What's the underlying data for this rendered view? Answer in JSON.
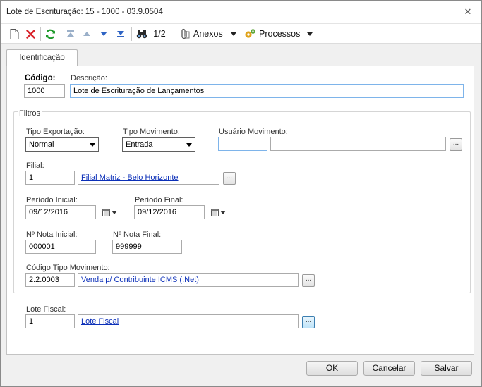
{
  "window": {
    "title": "Lote de Escrituração: 15 - 1000 - 03.9.0504",
    "close_glyph": "✕"
  },
  "toolbar": {
    "icons": [
      "new-icon",
      "delete-icon",
      "refresh-icon",
      "first-icon",
      "previous-icon",
      "next-icon",
      "last-icon",
      "search-binoculars-icon"
    ],
    "record_position": "1/2",
    "attachments_label": "Anexos",
    "processes_label": "Processos"
  },
  "tabs": [
    {
      "label": "Identificação"
    }
  ],
  "form": {
    "codigo": {
      "label": "Código:",
      "value": "1000"
    },
    "descricao": {
      "label": "Descrição:",
      "value": "Lote de Escrituração de Lançamentos"
    },
    "filtros": {
      "title": "Filtros",
      "tipo_exportacao": {
        "label": "Tipo Exportação:",
        "value": "Normal"
      },
      "tipo_movimento": {
        "label": "Tipo Movimento:",
        "value": "Entrada"
      },
      "usuario_movimento": {
        "label": "Usuário Movimento:",
        "code": "",
        "name": ""
      },
      "filial": {
        "label": "Filial:",
        "code": "1",
        "name": "Filial Matriz - Belo Horizonte"
      },
      "periodo_inicial": {
        "label": "Período Inicial:",
        "value": "09/12/2016"
      },
      "periodo_final": {
        "label": "Período Final:",
        "value": "09/12/2016"
      },
      "nota_inicial": {
        "label": "Nº Nota Inicial:",
        "value": "000001"
      },
      "nota_final": {
        "label": "Nº Nota Final:",
        "value": "999999"
      },
      "codigo_tipo_movimento": {
        "label": "Código Tipo Movimento:",
        "code": "2.2.0003",
        "name": "Venda p/ Contribuinte ICMS (.Net)"
      }
    },
    "lote_fiscal": {
      "label": "Lote Fiscal:",
      "code": "1",
      "name": "Lote Fiscal"
    },
    "lookup_glyph": "..."
  },
  "buttons": {
    "ok": "OK",
    "cancel": "Cancelar",
    "save": "Salvar"
  },
  "colors": {
    "link": "#0b2fb8",
    "focus_border": "#7eb4ea",
    "panel_bg": "#ffffff",
    "window_bg": "#f0f0f0"
  }
}
